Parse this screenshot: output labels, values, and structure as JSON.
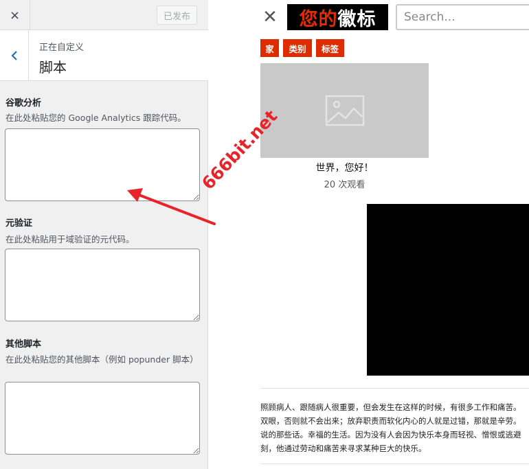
{
  "sidebar": {
    "close_icon": "×",
    "publish_label": "已发布",
    "header": {
      "subtitle": "正在自定义",
      "title": "脚本"
    },
    "fields": [
      {
        "label": "谷歌分析",
        "description": "在此处粘贴您的 Google Analytics 跟踪代码。",
        "value": ""
      },
      {
        "label": "元验证",
        "description": "在此处粘贴用于域验证的元代码。",
        "value": ""
      },
      {
        "label": "其他脚本",
        "description": "在此处粘贴您的其他脚本（例如 popunder 脚本）",
        "value": ""
      }
    ]
  },
  "preview": {
    "close_icon": "✕",
    "logo": {
      "part1": "您的",
      "part2": "徽标"
    },
    "search_placeholder": "Search...",
    "nav": [
      "家",
      "类别",
      "标签"
    ],
    "post": {
      "title": "世界，您好！",
      "views": "20 次观看"
    },
    "paragraph_lines": [
      "照顾病人、跟随病人很重要，但会发生在这样的时候，有很多工作和痛苦。",
      "双眼，否则就不会出来；放弃职责而软化内心的人就是过错，那就是辛劳。",
      "说的那些话。幸福的生活。因为没有人会因为快乐本身而轻视、憎恨或逃避",
      "刻，他通过劳动和痛苦来寻求某种巨大的快乐。"
    ]
  },
  "watermark": "666bit.net",
  "colors": {
    "accent": "#dd2d00",
    "wp_blue": "#2271b1",
    "arrow": "#e8242a"
  }
}
